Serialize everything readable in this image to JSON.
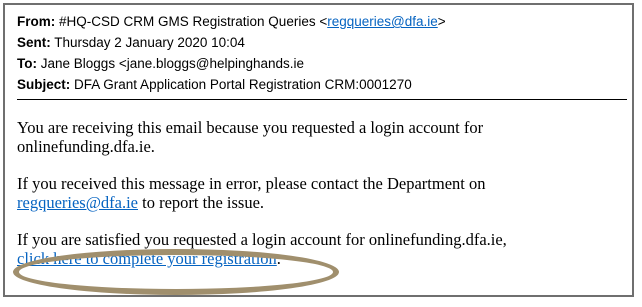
{
  "email": {
    "header": {
      "from_label": "From:",
      "from_name": "#HQ-CSD CRM GMS Registration Queries <",
      "from_email": "regqueries@dfa.ie",
      "from_close": ">",
      "sent_label": "Sent:",
      "sent_value": "Thursday 2 January 2020 10:04",
      "to_label": "To:",
      "to_value": "Jane Bloggs <jane.bloggs@helpinghands.ie",
      "subject_label": "Subject:",
      "subject_value": "DFA Grant Application Portal Registration CRM:0001270"
    },
    "body": {
      "para1": "You are receiving this email because you requested a login account for onlinefunding.dfa.ie.",
      "para2_pre": "If you received this message in error, please contact the Department on",
      "para2_link": "regqueries@dfa.ie",
      "para2_post": " to report the issue.",
      "para3_pre": "If you are satisfied you requested a login account for onlinefunding.dfa.ie,",
      "para3_link": "click here to complete your registration",
      "para3_post": "."
    },
    "colors": {
      "link": "#0563c1",
      "highlight": "#a08f6d",
      "border": "#6f6f6f"
    }
  }
}
